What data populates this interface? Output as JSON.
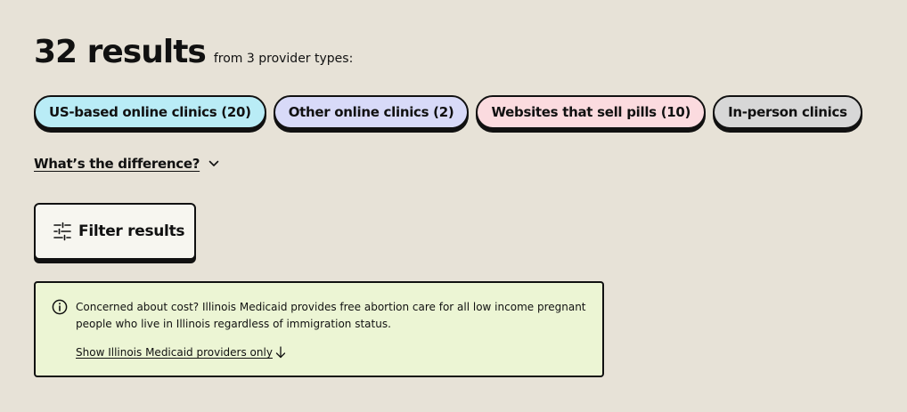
{
  "results": {
    "count_label": "32 results",
    "subtitle": "from 3 provider types:"
  },
  "filters": [
    {
      "label": "US-based online clinics (20)",
      "color": "#b9ecf6"
    },
    {
      "label": "Other online clinics (2)",
      "color": "#d8daf8"
    },
    {
      "label": "Websites that sell pills (10)",
      "color": "#fbdbdf"
    },
    {
      "label": "In-person clinics",
      "color": "#d7d7d7"
    }
  ],
  "difference": {
    "label": "What’s the difference?",
    "icon": "chevron-down-icon"
  },
  "filter_button": {
    "label": "Filter results",
    "icon": "sliders-icon"
  },
  "notice": {
    "icon": "info-icon",
    "text": "Concerned about cost? Illinois Medicaid provides free abortion care for all low income pregnant people who live in Illinois regardless of immigration status.",
    "link_label": "Show Illinois Medicaid providers only",
    "link_icon": "arrow-down-icon"
  }
}
